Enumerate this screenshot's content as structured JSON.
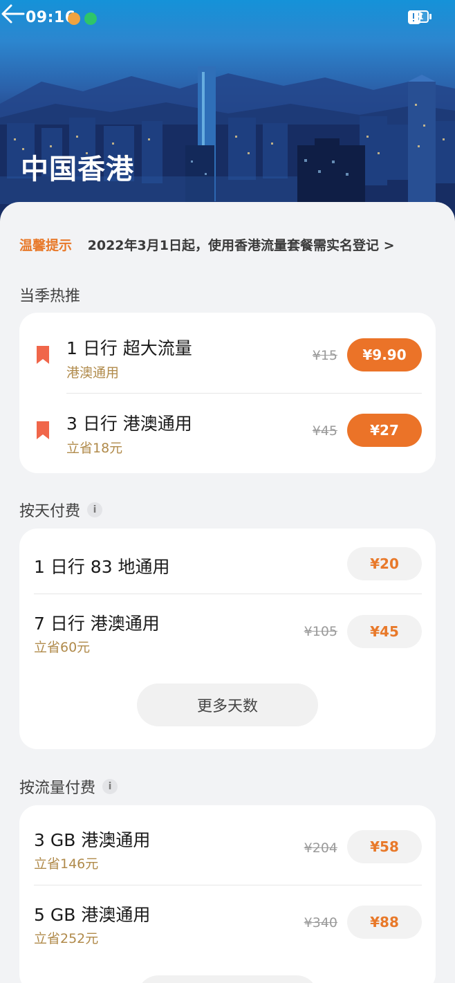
{
  "status_bar": {
    "time": "09:16",
    "battery": "81"
  },
  "header": {
    "title": "中国香港"
  },
  "notice": {
    "tag": "温馨提示",
    "message": "2022年3月1日起，使用香港流量套餐需实名登记 >"
  },
  "sections": {
    "hot": {
      "title": "当季热推",
      "items": [
        {
          "name": "1 日行  超大流量",
          "sub": "港澳通用",
          "orig_price": "¥15",
          "price": "¥9.90"
        },
        {
          "name": "3 日行  港澳通用",
          "sub": "立省18元",
          "orig_price": "¥45",
          "price": "¥27"
        }
      ]
    },
    "daily": {
      "title": "按天付费",
      "info_icon": "i",
      "items": [
        {
          "name": "1 日行  83 地通用",
          "price": "¥20"
        },
        {
          "name": "7 日行  港澳通用",
          "sub": "立省60元",
          "orig_price": "¥105",
          "price": "¥45"
        }
      ],
      "more_label": "更多天数"
    },
    "traffic": {
      "title": "按流量付费",
      "info_icon": "i",
      "items": [
        {
          "name": "3 GB 港澳通用",
          "sub": "立省146元",
          "orig_price": "¥204",
          "price": "¥58"
        },
        {
          "name": "5 GB 港澳通用",
          "sub": "立省252元",
          "orig_price": "¥340",
          "price": "¥88"
        }
      ]
    }
  },
  "colors": {
    "accent": "#eb7328",
    "sub_text": "#b08a4a",
    "background": "#f2f3f5"
  }
}
